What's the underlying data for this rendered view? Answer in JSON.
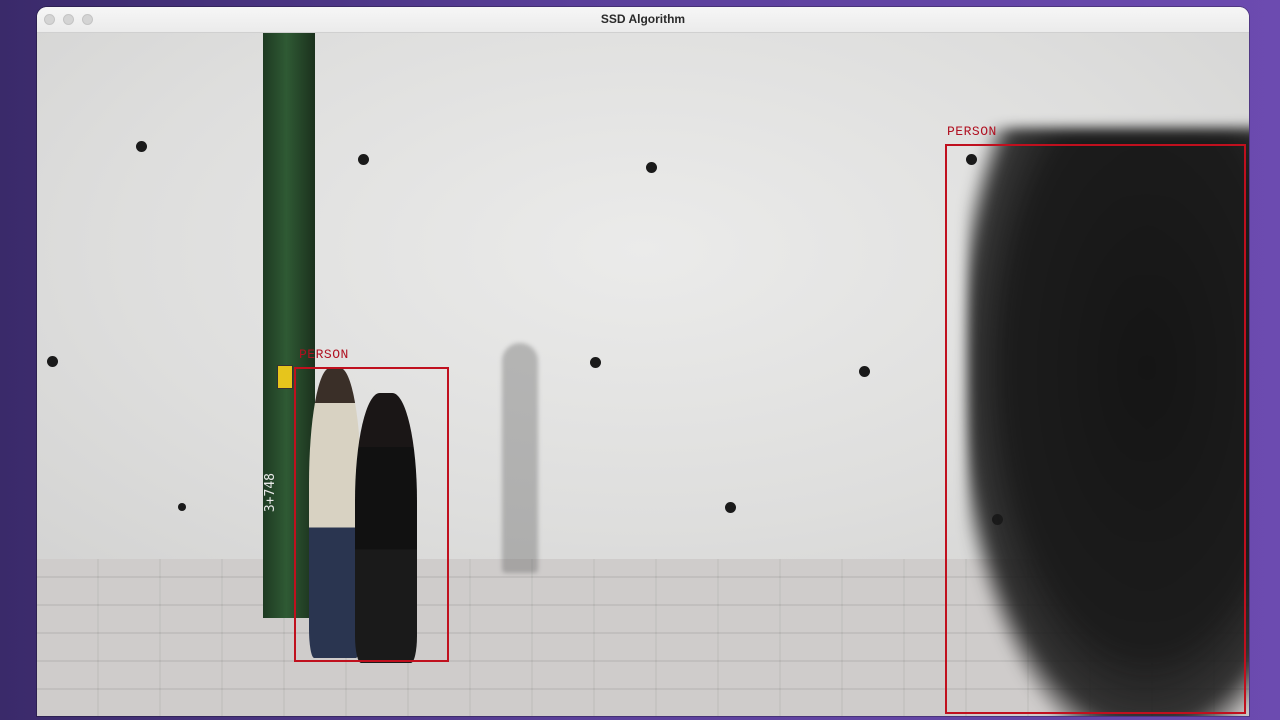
{
  "window": {
    "title": "SSD Algorithm"
  },
  "scene": {
    "pole_text": "3+748",
    "colors": {
      "box": "#c0101e",
      "label": "#b01020"
    }
  },
  "detections": [
    {
      "label": "PERSON"
    },
    {
      "label": "PERSON"
    }
  ]
}
